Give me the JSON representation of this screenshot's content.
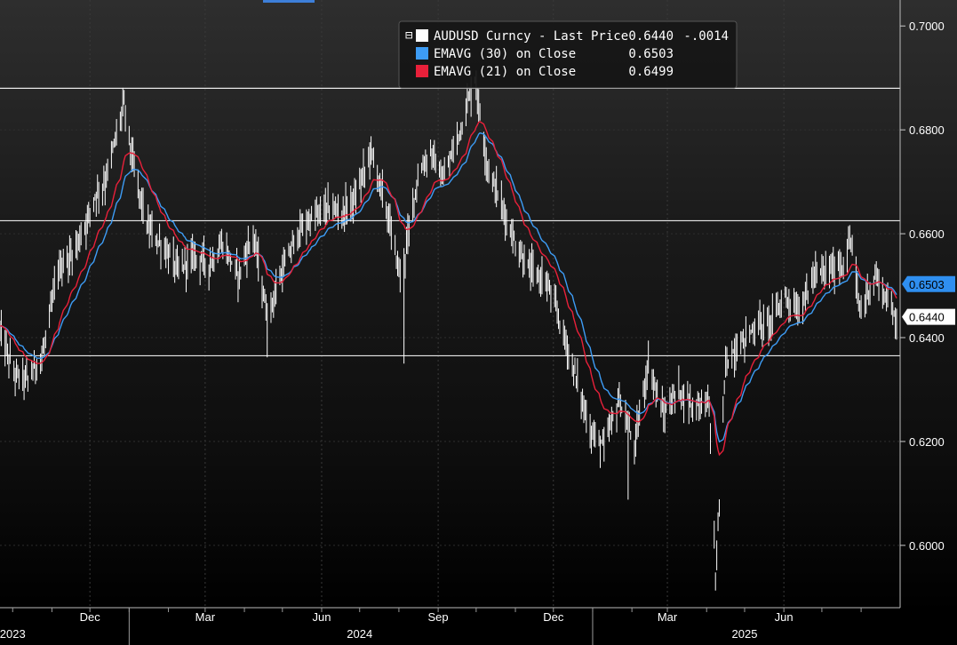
{
  "chart_data": {
    "type": "line",
    "legend": {
      "main_series": "AUDUSD Curncy - Last Price",
      "main_last": "0.6440",
      "main_change": "-.0014",
      "ema30_label": "EMAVG (30)",
      "ema30_suffix": "on Close",
      "ema30_last": "0.6503",
      "ema21_label": "EMAVG (21)",
      "ema21_suffix": "on Close",
      "ema21_last": "0.6499"
    },
    "ylim": [
      0.588,
      0.705
    ],
    "y_ticks": [
      "0.6000",
      "0.6200",
      "0.6400",
      "0.6600",
      "0.6800",
      "0.7000"
    ],
    "y_tick_values": [
      0.6,
      0.62,
      0.64,
      0.66,
      0.68,
      0.7
    ],
    "x_month_labels": [
      "Dec",
      "Mar",
      "Jun",
      "Sep",
      "Dec",
      "Mar",
      "Jun"
    ],
    "x_month_dates": [
      "2023-12-01",
      "2024-03-01",
      "2024-06-01",
      "2024-09-01",
      "2024-12-01",
      "2025-03-01",
      "2025-06-01"
    ],
    "x_year_labels": [
      "2023",
      "2024",
      "2025"
    ],
    "x_year_dates": [
      "2023-10-01",
      "2024-07-01",
      "2025-05-01"
    ],
    "x_range": [
      "2023-09-21",
      "2025-08-29"
    ],
    "horizontal_lines": [
      0.688,
      0.6625,
      0.6365
    ],
    "value_tags": [
      {
        "text": "0.6503",
        "value": 0.6503,
        "bg": "#2f8ff0",
        "fg": "#000000"
      },
      {
        "text": "0.6440",
        "value": 0.644,
        "bg": "#ffffff",
        "fg": "#000000"
      }
    ],
    "price": [
      [
        "2023-09-21",
        0.6415
      ],
      [
        "2023-10-02",
        0.633
      ],
      [
        "2023-10-13",
        0.632
      ],
      [
        "2023-10-25",
        0.637
      ],
      [
        "2023-11-06",
        0.653
      ],
      [
        "2023-11-17",
        0.656
      ],
      [
        "2023-11-28",
        0.662
      ],
      [
        "2023-12-04",
        0.667
      ],
      [
        "2023-12-13",
        0.67
      ],
      [
        "2023-12-22",
        0.679
      ],
      [
        "2023-12-28",
        0.685
      ],
      [
        "2024-01-05",
        0.672
      ],
      [
        "2024-01-16",
        0.661
      ],
      [
        "2024-01-29",
        0.657
      ],
      [
        "2024-02-09",
        0.653
      ],
      [
        "2024-02-22",
        0.656
      ],
      [
        "2024-03-04",
        0.654
      ],
      [
        "2024-03-15",
        0.658
      ],
      [
        "2024-03-27",
        0.652
      ],
      [
        "2024-04-08",
        0.66
      ],
      [
        "2024-04-19",
        0.644
      ],
      [
        "2024-04-30",
        0.652
      ],
      [
        "2024-05-13",
        0.66
      ],
      [
        "2024-05-24",
        0.663
      ],
      [
        "2024-06-06",
        0.665
      ],
      [
        "2024-06-18",
        0.664
      ],
      [
        "2024-06-28",
        0.667
      ],
      [
        "2024-07-10",
        0.676
      ],
      [
        "2024-07-22",
        0.665
      ],
      [
        "2024-08-02",
        0.652
      ],
      [
        "2024-08-06",
        0.656
      ],
      [
        "2024-08-15",
        0.67
      ],
      [
        "2024-08-26",
        0.676
      ],
      [
        "2024-09-05",
        0.67
      ],
      [
        "2024-09-17",
        0.679
      ],
      [
        "2024-09-30",
        0.69
      ],
      [
        "2024-10-10",
        0.673
      ],
      [
        "2024-10-22",
        0.665
      ],
      [
        "2024-11-01",
        0.658
      ],
      [
        "2024-11-12",
        0.653
      ],
      [
        "2024-11-25",
        0.651
      ],
      [
        "2024-12-05",
        0.644
      ],
      [
        "2024-12-17",
        0.634
      ],
      [
        "2024-12-30",
        0.622
      ],
      [
        "2025-01-10",
        0.619
      ],
      [
        "2025-01-22",
        0.628
      ],
      [
        "2025-02-03",
        0.619
      ],
      [
        "2025-02-14",
        0.635
      ],
      [
        "2025-02-26",
        0.625
      ],
      [
        "2025-03-10",
        0.63
      ],
      [
        "2025-03-21",
        0.627
      ],
      [
        "2025-04-03",
        0.628
      ],
      [
        "2025-04-08",
        0.593
      ],
      [
        "2025-04-16",
        0.635
      ],
      [
        "2025-04-28",
        0.639
      ],
      [
        "2025-05-09",
        0.642
      ],
      [
        "2025-05-21",
        0.643
      ],
      [
        "2025-06-02",
        0.648
      ],
      [
        "2025-06-13",
        0.645
      ],
      [
        "2025-06-25",
        0.652
      ],
      [
        "2025-07-07",
        0.653
      ],
      [
        "2025-07-18",
        0.654
      ],
      [
        "2025-07-24",
        0.659
      ],
      [
        "2025-07-31",
        0.645
      ],
      [
        "2025-08-12",
        0.652
      ],
      [
        "2025-08-22",
        0.647
      ],
      [
        "2025-08-29",
        0.644
      ]
    ]
  }
}
